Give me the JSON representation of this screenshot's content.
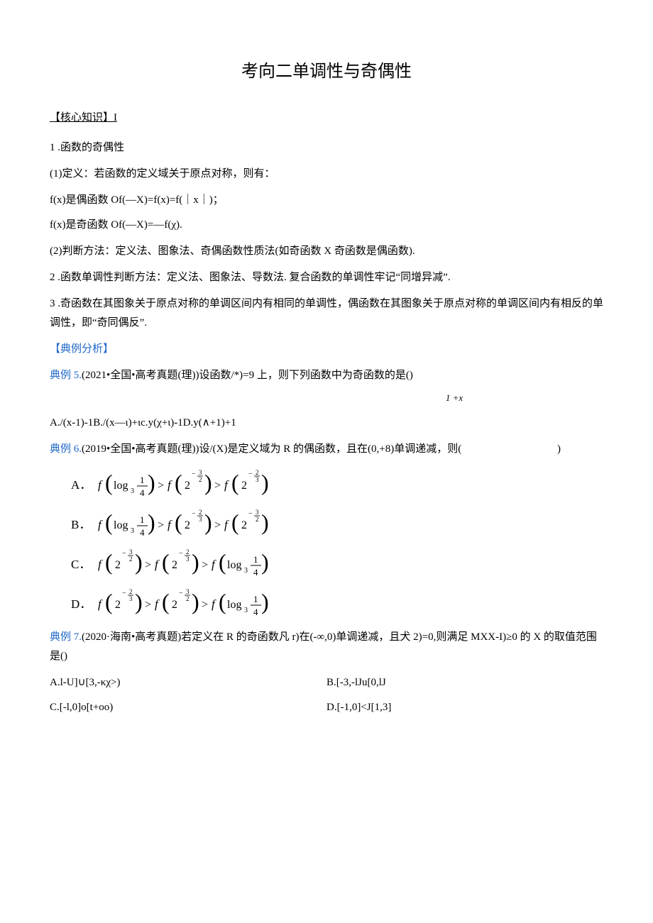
{
  "title": "考向二单调性与奇偶性",
  "sectionHeader": "【核心知识】I",
  "p1": "1 .函数的奇偶性",
  "p2": "(1)定义：若函数的定义域关于原点对称，则有：",
  "p3": "f(x)是偶函数 Of(—X)=f(x)=f(｜x｜)；",
  "p4": "f(x)是奇函数 Of(—X)=—f(χ).",
  "p5": "(2)判断方法：定义法、图象法、奇偶函数性质法(如奇函数 X 奇函数是偶函数).",
  "p6": "2 .函数单调性判断方法：定义法、图象法、导数法. 复合函数的单调性牢记“同增异减”.",
  "p7": "3 .奇函数在其图象关于原点对称的单调区间内有相同的单调性，偶函数在其图象关于原点对称的单调区间内有相反的单调性，即“奇同偶反”.",
  "dianli_header": "【典例分析】",
  "ex5_label": "典例 5.",
  "ex5_text": "(2021•全国•高考真题(理))设函数/*)=9 上，则下列函数中为奇函数的是()",
  "ex5_frac": "1 +x",
  "ex5_options": "A./(x-1)-1B./(x—ι)+ιc.y(χ+ι)-1D.y(∧+1)+1",
  "ex6_label": "典例 6.",
  "ex6_text": "(2019•全国•高考真题(理))设/(X)是定义域为 R 的偶函数，且在(0,+8)单调递减，则(",
  "ex6_paren": ")",
  "ex7_label": "典例 7.",
  "ex7_text": "(2020·海南•高考真题)若定义在 R 的奇函数凡 r)在(-∞,0)单调递减，且犬 2)=0,则满足 MXX-I)≥0 的 X 的取值范围是()",
  "ex7_optA": "A.l-U]∪[3,-κχ>)",
  "ex7_optB": "B.[-3,-lJu[0,lJ",
  "ex7_optC": "C.[-l,0]o[t+oo)",
  "ex7_optD": "D.[-1,0]<J[1,3]"
}
